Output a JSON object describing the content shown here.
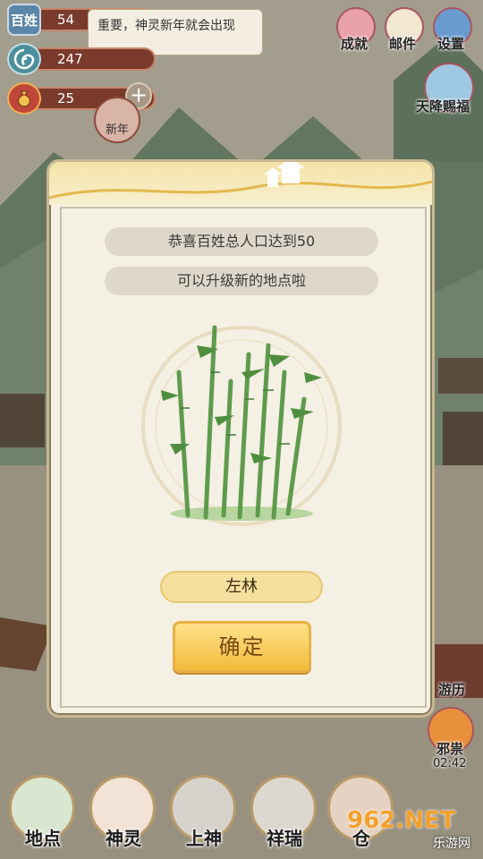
{
  "resources": {
    "population": {
      "icon_text": "百姓",
      "value": "54"
    },
    "spirit": {
      "value": "247"
    },
    "gold": {
      "value": "25"
    }
  },
  "notice": {
    "text": "重要，神灵新年就会出现"
  },
  "event_badge": {
    "label": "新年"
  },
  "right_menu": {
    "achievements": "成就",
    "mail": "邮件",
    "settings": "设置",
    "blessing": "天降赐福",
    "journey": "游历",
    "evil": "邪祟",
    "timer": "02:42"
  },
  "dialog": {
    "line1": "恭喜百姓总人口达到50",
    "line2": "可以升级新的地点啦",
    "location_name": "左林",
    "confirm": "确定"
  },
  "bottom_nav": [
    "地点",
    "神灵",
    "上神",
    "祥瑞",
    "仓"
  ],
  "watermark": {
    "brand": "962.NET",
    "sub": "乐游网"
  }
}
